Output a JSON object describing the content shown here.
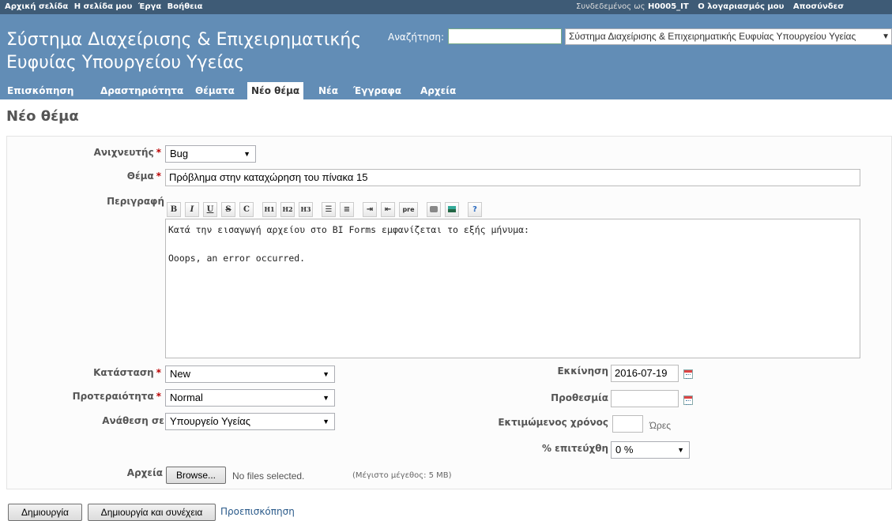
{
  "top_menu": {
    "left_items": [
      "Αρχική σελίδα",
      "Η σελίδα μου",
      "Έργα",
      "Βοήθεια"
    ],
    "logged_in_prefix": "Συνδεδεμένος ως",
    "user": "H0005_IT",
    "my_account": "Ο λογαριασμός μου",
    "logout": "Αποσύνδεσ"
  },
  "header": {
    "title": "Σύστημα Διαχείρισης & Επιχειρηματικής Ευφυίας Υπουργείου Υγείας",
    "search_label": "Αναζήτηση:",
    "search_value": "",
    "project_selected": "Σύστημα Διαχείρισης & Επιχειρηματικής Ευφυίας Υπουργείου Υγείας"
  },
  "main_menu": {
    "tabs": [
      "Επισκόπηση",
      "Δραστηριότητα",
      "Θέματα",
      "Νέο θέμα",
      "Νέα",
      "Έγγραφα",
      "Αρχεία"
    ],
    "selected": "Νέο θέμα"
  },
  "page": {
    "title": "Νέο θέμα"
  },
  "form": {
    "tracker_label": "Ανιχνευτής",
    "tracker_value": "Bug",
    "subject_label": "Θέμα",
    "subject_value": "Πρόβλημα στην καταχώρηση του πίνακα 15",
    "description_label": "Περιγραφή",
    "description_value": "Κατά την εισαγωγή αρχείου στο BI Forms εμφανίζεται το εξής μήνυμα:\n\nOoops, an error occurred.",
    "toolbar": [
      "B",
      "I",
      "U",
      "S",
      "C",
      "H1",
      "H2",
      "H3",
      "pre"
    ],
    "status_label": "Κατάσταση",
    "status_value": "New",
    "priority_label": "Προτεραιότητα",
    "priority_value": "Normal",
    "assignee_label": "Ανάθεση σε",
    "assignee_value": "Υπουργείο Υγείας",
    "start_label": "Εκκίνηση",
    "start_value": "2016-07-19",
    "due_label": "Προθεσμία",
    "due_value": "",
    "estimate_label": "Εκτιμώμενος χρόνος",
    "estimate_value": "",
    "estimate_unit": "Ώρες",
    "done_label": "% επιτεύχθη",
    "done_value": "0 %",
    "files_label": "Αρχεία",
    "browse_label": "Browse...",
    "no_files": "No files selected.",
    "max_size": "(Μέγιστο μέγεθος: 5 MB)"
  },
  "actions": {
    "create": "Δημιουργία",
    "create_continue": "Δημιουργία και συνέχεια",
    "preview": "Προεπισκόπηση"
  },
  "colors": {
    "header_bg": "#628db6",
    "top_menu_bg": "#3e5b76",
    "required": "#bb0000"
  }
}
